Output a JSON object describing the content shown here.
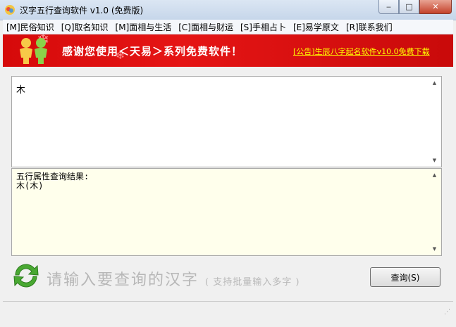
{
  "window": {
    "title": "汉字五行查询软件 v1.0 (免费版)",
    "controls": {
      "minimize": "‒",
      "maximize": "□",
      "close": "✕"
    }
  },
  "menu": [
    {
      "label": "[M]民俗知识"
    },
    {
      "label": "[Q]取名知识"
    },
    {
      "label": "[M]面相与生活"
    },
    {
      "label": "[C]面相与财运"
    },
    {
      "label": "[S]手相占卜"
    },
    {
      "label": "[E]易学原文"
    },
    {
      "label": "[R]联系我们"
    }
  ],
  "banner": {
    "text": "感谢您使用＜天易＞系列免费软件！",
    "notice_link": "[公告]生辰八字起名软件v10.0免费下载",
    "colors": {
      "background": "#e01010",
      "text": "#ffffff",
      "link": "#ffff00"
    }
  },
  "input": {
    "value": "木"
  },
  "result": {
    "heading": "五行属性查询结果:",
    "line1": "木(木)"
  },
  "prompt": {
    "main": "请输入要查询的汉字",
    "hint": "( 支持批量输入多字 )"
  },
  "query_button": {
    "label": "查询(S)"
  },
  "icons": {
    "app": "app-logo-icon",
    "refresh": "refresh-arrows-icon",
    "people": "people-logo-icon"
  }
}
